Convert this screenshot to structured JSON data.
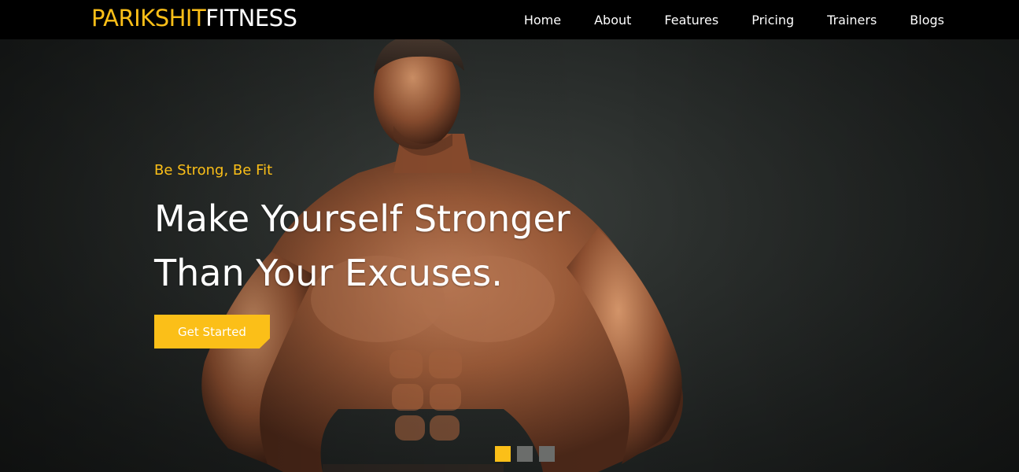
{
  "brand": {
    "name_part1": "PARIKSHIT",
    "name_part2": "FITNESS",
    "accent_color": "#fbbf18"
  },
  "nav": {
    "items": [
      {
        "label": "Home"
      },
      {
        "label": "About"
      },
      {
        "label": "Features"
      },
      {
        "label": "Pricing"
      },
      {
        "label": "Trainers"
      },
      {
        "label": "Blogs"
      }
    ]
  },
  "hero": {
    "tagline": "Be Strong, Be Fit",
    "headline_line1": "Make Yourself Stronger",
    "headline_line2": "Than Your Excuses.",
    "cta_label": "Get Started",
    "image": "muscular-man-photo",
    "slides": {
      "count": 3,
      "active_index": 0
    }
  }
}
